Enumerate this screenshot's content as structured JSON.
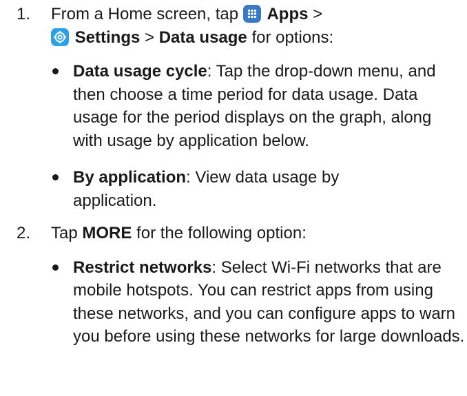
{
  "steps": [
    {
      "number": "1.",
      "parts": {
        "t1": "From a Home screen, tap",
        "apps_label": "Apps",
        "sep1": ">",
        "settings_label": "Settings",
        "sep2": ">",
        "data_usage_label": "Data usage",
        "t2": "for options:"
      },
      "icons": {
        "apps": "apps-grid-icon",
        "settings": "settings-gear-icon"
      },
      "bullets": [
        {
          "term": "Data usage cycle",
          "text": ": Tap the drop-down menu, and then choose a time period for data usage. Data usage for the period displays on the graph, along with usage by application below."
        },
        {
          "term": "By application",
          "text": ": View data usage by application."
        }
      ]
    },
    {
      "number": "2.",
      "parts": {
        "t1": "Tap",
        "more_label": "MORE",
        "t2": "for the following option:"
      },
      "bullets": [
        {
          "term": "Restrict networks",
          "text": ": Select Wi-Fi networks that are mobile hotspots. You can restrict apps from using these networks, and you can configure apps to warn you before using these networks for large downloads."
        }
      ]
    }
  ],
  "colors": {
    "apps_icon_bg": "#3a78c8",
    "settings_icon_bg": "#2ea0e6",
    "text": "#1a1a1a"
  }
}
